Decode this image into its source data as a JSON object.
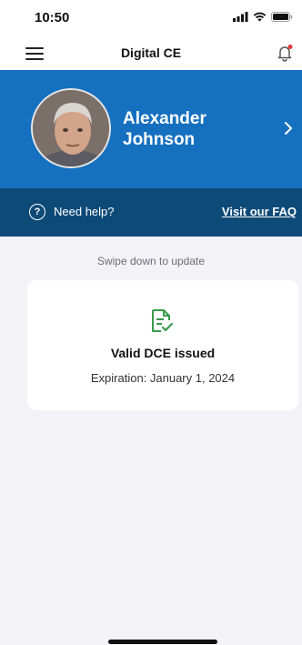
{
  "status_bar": {
    "time": "10:50"
  },
  "header": {
    "title": "Digital CE",
    "notification_dot_color": "#e53935"
  },
  "profile": {
    "name": "Alexander\nJohnson",
    "background_color": "#1570c0"
  },
  "help": {
    "label": "Need help?",
    "faq_link": "Visit our FAQ",
    "background_color": "#0e4a78"
  },
  "refresh_hint": "Swipe down to update",
  "dce_card": {
    "status": "Valid DCE issued",
    "expiration": "Expiration: January 1, 2024",
    "icon": "document-check-icon",
    "icon_color": "#3a9a4a"
  }
}
